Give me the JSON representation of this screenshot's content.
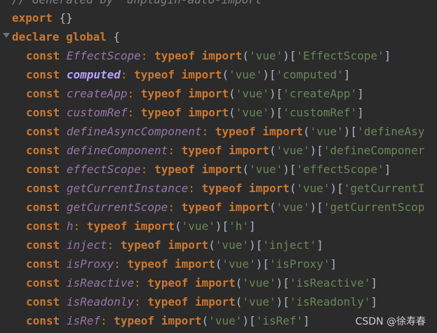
{
  "code": {
    "comment": "// Generated by 'unplugin-auto-import'",
    "export_line": [
      "export",
      "{}"
    ],
    "declare_line": [
      "declare",
      "global",
      "{"
    ],
    "kw_const": "const",
    "kw_typeof": "typeof",
    "kw_import": "import",
    "module": "'vue'",
    "entries": [
      {
        "name": "EffectScope",
        "key": "'EffectScope'"
      },
      {
        "name": "computed",
        "key": "'computed'"
      },
      {
        "name": "createApp",
        "key": "'createApp'"
      },
      {
        "name": "customRef",
        "key": "'customRef'"
      },
      {
        "name": "defineAsyncComponent",
        "key": "'defineAsy"
      },
      {
        "name": "defineComponent",
        "key": "'defineComponer"
      },
      {
        "name": "effectScope",
        "key": "'effectScope'"
      },
      {
        "name": "getCurrentInstance",
        "key": "'getCurrentI"
      },
      {
        "name": "getCurrentScope",
        "key": "'getCurrentScop"
      },
      {
        "name": "h",
        "key": "'h'"
      },
      {
        "name": "inject",
        "key": "'inject'"
      },
      {
        "name": "isProxy",
        "key": "'isProxy'"
      },
      {
        "name": "isReactive",
        "key": "'isReactive'"
      },
      {
        "name": "isReadonly",
        "key": "'isReadonly'"
      },
      {
        "name": "isRef",
        "key": "'isRef'"
      }
    ],
    "highlighted": "computed"
  },
  "watermark": "CSDN @徐寿春"
}
